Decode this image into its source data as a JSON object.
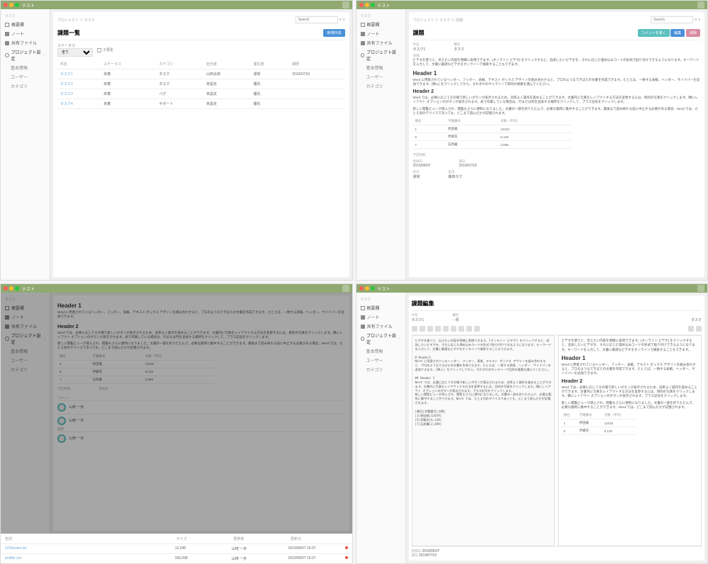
{
  "app_title": "テスト",
  "sidebar": {
    "section_label": "タスク",
    "items": [
      {
        "label": "概要欄"
      },
      {
        "label": "ノート"
      },
      {
        "label": "共有ファイル"
      },
      {
        "label": "プロジェクト設定",
        "sel": true,
        "expand": "−"
      }
    ],
    "sub_items": [
      {
        "label": "基本情報"
      },
      {
        "label": "ユーザー"
      },
      {
        "label": "カテゴリ"
      }
    ]
  },
  "pane1": {
    "crumbs": "プロジェクト ＞ タスク",
    "search_ph": "Search",
    "title": "課題一覧",
    "create_btn": "新規作成",
    "filter_label": "ステータス",
    "filter_all": "全て",
    "checkbox_label": "子要素",
    "cols": [
      "件名",
      "ステータス",
      "カテゴリ",
      "担当者",
      "優先度",
      "期限"
    ],
    "rows": [
      {
        "subj": "タスク1",
        "st": "未着",
        "cat": "タスク",
        "asn": "山田太郎",
        "pri": "通常",
        "due": "2019/07/19"
      },
      {
        "subj": "タスク2",
        "st": "未着",
        "cat": "タスク",
        "asn": "未設定",
        "pri": "優先",
        "due": ""
      },
      {
        "subj": "タスク3",
        "st": "未着",
        "cat": "バグ",
        "asn": "未設定",
        "pri": "優先",
        "due": ""
      },
      {
        "subj": "タスク4",
        "st": "未着",
        "cat": "サポート",
        "asn": "未設定",
        "pri": "優先",
        "due": ""
      }
    ]
  },
  "pane2": {
    "crumbs": "プロジェクト ＞ タスク ＞ 詳細",
    "search_ph": "Search",
    "title": "課題",
    "btn_comment": "コメントを書く",
    "btn_edit": "編集",
    "btn_delete": "削除",
    "fields": {
      "subject_lbl": "件名",
      "subject": "タスク1",
      "category_lbl": "種別",
      "category": "タスク"
    },
    "desc_lbl": "詳細",
    "para1": "ビデオを使うと、伝えたい内容を明確に表現できます。[オンライン ビデオ] をクリックすると、追加したいビデオを、それに応じた埋め込みコードの形式で貼り付けできるようになります。キーワードを入力して、文書に最適なビデオをオンラインで検索することもできます。",
    "h1": "Header 1",
    "para2": "Word に用意されているヘッダー、フッター、表紙、テキスト ボックス デザインを組み合わせると、プロのようなできばえの文書を作成できます。たとえば、一致する表紙、ヘッダー、サイドバーを追加できます。[挿入] をクリックしてから、それぞれのギャラリーで目的の要素を選んでください。",
    "h2": "Header 2",
    "para3": "Word では、必要に応じてその場で新しいボタンが表示されるため、効率よく操作を進めることができます。文書内に写真をレイアウトする方法を変更するには、目的の写真をクリックします。隣にレイアウト オプションのボタンが表示されます。表で作業している場合は、行または列を追加する場所をクリックして、プラス記号をクリックします。",
    "para4": "新しい閲覧ビューが導入され、閲覧もさらに便利になりました。文書の一部を折りたたんで、必要な箇所に集中することができます。最後まで読み終わる前に中止する必要がある場合、Word では、たとえ別のデバイスであっても、どこまで読んだかが記憶されます。",
    "mini_th": [
      "順位",
      "学籍番号",
      "点数（平均）"
    ],
    "mini_rows": [
      [
        "1",
        "原田雅",
        "12019"
      ],
      [
        "5",
        "伊藤花",
        "6,128"
      ],
      [
        "7",
        "石原翼",
        "2,699"
      ]
    ],
    "footer_lbl": "予定時間",
    "dates": {
      "created_lbl": "登録日",
      "created": "2019/06/07",
      "due_lbl": "期日",
      "due": "2019/07/19",
      "status_lbl": "状況",
      "status": "通常",
      "asn_lbl": "担当",
      "asn": "藤田タク"
    }
  },
  "pane3": {
    "h1": "Header 1",
    "para1": "Word に用意されているヘッダー、フッター、表紙、テキスト ボックス デザインを組み合わせると、プロのようなできばえの文書を作成できます。たとえば、一致する表紙、ヘッダー、サイドバーを追加できます。",
    "h2": "Header 2",
    "para2": "Word では、必要に応じてその場で新しいボタンが表示されるため、効率よく操作を進めることができます。文書内に写真をレイアウトする方法を変更するには、目的の写真をクリックします。隣にレイアウト オプションのボタンが表示されます。表で作業している場合は、行または列を追加する場所をクリックして、プラス記号をクリックします。",
    "para3": "新しい閲覧ビューが導入され、閲覧もさらに便利になりました。文書の一部を折りたたんで、必要な箇所に集中することができます。最後まで読み終わる前に中止する必要がある場合、Word では、たとえ別のデバイスであっても、どこまで読んだかが記憶されます。",
    "mini_th": [
      "順位",
      "学籍番号",
      "点数（平均）"
    ],
    "mini_rows": [
      [
        "1",
        "原田雅",
        "12019"
      ],
      [
        "5",
        "伊藤花",
        "6,128"
      ],
      [
        "7",
        "石原翼",
        "2,699"
      ]
    ],
    "sec_time": "予定時間",
    "sec_upd": "更新日",
    "comments_lbl": "コメント",
    "history_lbl": "履歴",
    "comments": [
      {
        "user": "山崎 一歩"
      },
      {
        "user": "山崎 一歩"
      }
    ],
    "files": {
      "headers": [
        "名前",
        "サイズ",
        "更新者",
        "更新日"
      ],
      "rows": [
        {
          "name": "1234notes.txt",
          "size": "12,048",
          "user": "山崎 一歩",
          "date": "2019/06/07 15:07"
        },
        {
          "name": "testfile.csv",
          "size": "336,098",
          "user": "山崎 一歩",
          "date": "2019/06/07 15:07"
        }
      ]
    }
  },
  "pane4": {
    "title": "課題編集",
    "subject_lbl": "件名",
    "subject": "タスク1",
    "type_lbl": "種別",
    "type": "タスク",
    "priority_opt": "− 低",
    "left_raw": "ビデオを使うと、伝えたい内容を明確に表現できます。[オンライン ビデオ] をクリックすると、追加したいビデオを、それに応じた埋め込みコードの形式で貼り付けできるようになります。キーワードを入力して、文書に最適なビデオをオンラインで検索することもできます。\n\n# Header1\nWord に用意されているヘッダー、フッター、表紙、テキスト ボックス デザインを組み合わせると、プロのようなできばえの文書を作成できます。たとえば、一致する表紙、ヘッダー、サイドバーを追加できます。[挿入] をクリックしてから、それぞれのギャラリーで目的の要素を選んでください。\n\n## Header 2\nWord では、必要に応じてその場で新しいボタンが表示されるため、効率よく操作を進めることができます。文書内に写真をレイアウトする方法を変更するには、目的の写真をクリックします。隣にレイアウト オプションのボタンが表示されます。プラス記号をクリックします。\n新しい閲覧ビューが導入され、閲覧もさらに便利になりました。文書の一部を折りたたんで、必要な箇所に集中することができます。Word では、たとえ別のデバイスであっても、どこまで読んだかが記憶されます。\n\n|順位|学籍番号|点数|\n|1|原田雅|12019|\n|5|伊藤花|6,128|\n|7|石原翼|2,699|",
    "right": {
      "p1": "ビデオを使うと、伝えたい内容を明確に表現できます。[オンライン ビデオ] をクリックすると、追加したいビデオを、それに応じた埋め込みコードの形式で貼り付けできるようになります。キーワードを入力して、文書に最適なビデオをオンラインで検索することもできます。",
      "h1": "Header 1",
      "p2": "Word に用意されているヘッダー、フッター、表紙、テキスト ボックス デザインを組み合わせると、プロのようなできばえの文書を作成できます。たとえば、一致する表紙、ヘッダー、サイドバーを追加できます。",
      "h2": "Header 2",
      "p3": "Word では、必要に応じてその場で新しいボタンが表示されるため、効率よく操作を進めることができます。文書内に写真をレイアウトする方法を変更するには、目的の写真をクリックします。隣にレイアウト オプションのボタンが表示されます。プラス記号をクリックします。",
      "p4": "新しい閲覧ビューが導入され、閲覧もさらに便利になりました。文書の一部を折りたたんで、必要な箇所に集中することができます。Word では、どこまで読んだかが記憶されます。",
      "mini_th": [
        "順位",
        "学籍番号",
        "点数（平均）"
      ],
      "mini_rows": [
        [
          "1",
          "原田雅",
          "12019"
        ],
        [
          "5",
          "伊藤花",
          "6,128"
        ]
      ]
    },
    "footer_date_lbl": "登録日",
    "footer_date": "2019/06/07",
    "footer_due_lbl": "期日",
    "footer_due": "2019/07/19"
  }
}
